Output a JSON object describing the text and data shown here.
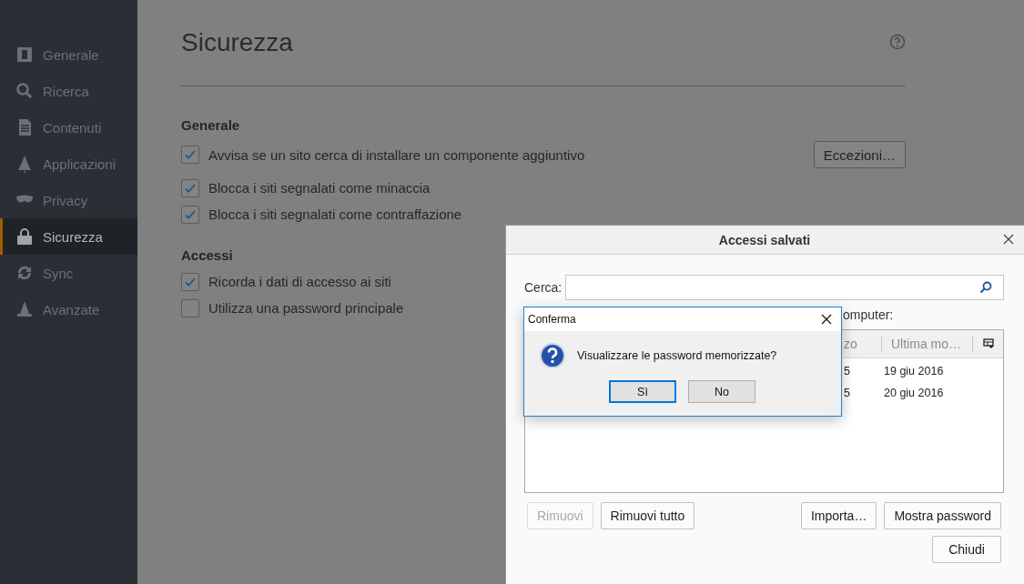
{
  "sidebar": {
    "items": [
      {
        "label": "Generale",
        "selected": false
      },
      {
        "label": "Ricerca",
        "selected": false
      },
      {
        "label": "Contenuti",
        "selected": false
      },
      {
        "label": "Applicazioni",
        "selected": false
      },
      {
        "label": "Privacy",
        "selected": false
      },
      {
        "label": "Sicurezza",
        "selected": true
      },
      {
        "label": "Sync",
        "selected": false
      },
      {
        "label": "Avanzate",
        "selected": false
      }
    ]
  },
  "page": {
    "title": "Sicurezza",
    "sections": [
      {
        "heading": "Generale",
        "button": "Eccezioni…",
        "options": [
          {
            "label": "Avvisa se un sito cerca di installare un componente aggiuntivo",
            "checked": true
          },
          {
            "label": "Blocca i siti segnalati come minaccia",
            "checked": true
          },
          {
            "label": "Blocca i siti segnalati come contraffazione",
            "checked": true
          }
        ]
      },
      {
        "heading": "Accessi",
        "options": [
          {
            "label": "Ricorda i dati di accesso ai siti",
            "checked": true
          },
          {
            "label": "Utilizza una password principale",
            "checked": false
          }
        ]
      }
    ]
  },
  "saved_logins": {
    "title": "Accessi salvati",
    "search_label": "Cerca:",
    "list_label": "omputer:",
    "columns": [
      "zo",
      "Ultima mo…"
    ],
    "rows": [
      {
        "cells": [
          "5",
          "19 giu 2016"
        ]
      },
      {
        "cells": [
          "5",
          "20 giu 2016"
        ]
      }
    ],
    "buttons_left": [
      {
        "label": "Rimuovi",
        "disabled": true
      },
      {
        "label": "Rimuovi tutto",
        "disabled": false
      }
    ],
    "buttons_right": [
      {
        "label": "Importa…",
        "disabled": false
      },
      {
        "label": "Mostra password",
        "disabled": false
      }
    ],
    "close_button": "Chiudi"
  },
  "confirm": {
    "title": "Conferma",
    "message": "Visualizzare le password memorizzate?",
    "buttons": [
      {
        "label": "Sì",
        "selected": true
      },
      {
        "label": "No",
        "selected": false
      }
    ]
  }
}
